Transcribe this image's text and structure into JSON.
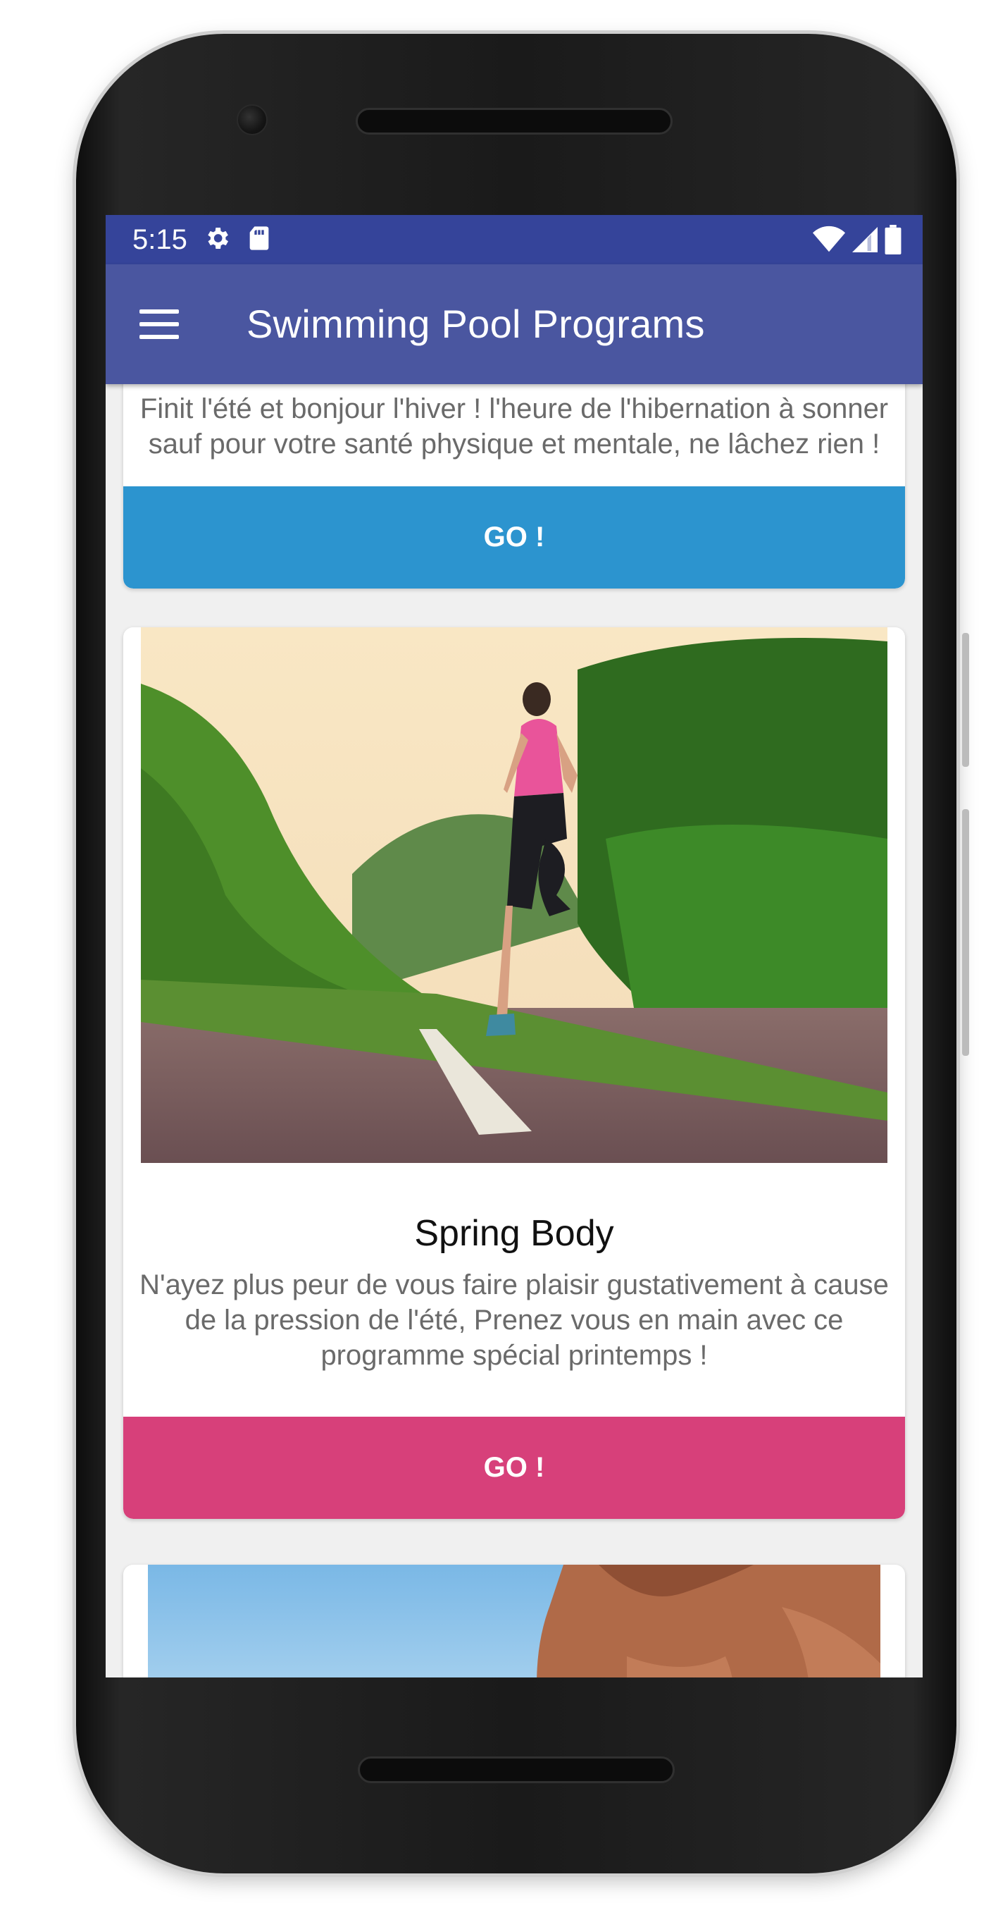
{
  "status_bar": {
    "time": "5:15",
    "icons_left": [
      "gear-icon",
      "sd-card-icon"
    ],
    "icons_right": [
      "wifi-icon",
      "cell-signal-icon",
      "battery-icon"
    ]
  },
  "app_bar": {
    "menu_icon": "hamburger-menu-icon",
    "title": "Swimming Pool Programs"
  },
  "cards": [
    {
      "description": "Finit l'été et bonjour l'hiver ! l'heure de l'hibernation à sonner sauf pour votre santé physique et mentale, ne lâchez rien !",
      "button_label": "GO !",
      "button_color": "#2c94cf"
    },
    {
      "image": "woman running on road photo",
      "title": "Spring Body",
      "description": "N'ayez plus peur de vous faire plaisir gustativement à cause de la pression de l'été, Prenez vous en main avec ce programme spécial printemps !",
      "button_label": "GO !",
      "button_color": "#d7407a"
    },
    {
      "image": "shirtless man with sky background photo"
    }
  ],
  "colors": {
    "status_bar": "#35449a",
    "app_bar": "#4a56a0"
  }
}
